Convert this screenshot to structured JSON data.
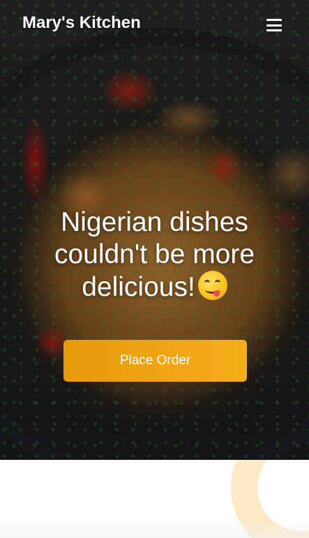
{
  "navbar": {
    "brand": "Mary's Kitchen",
    "menu_icon": "hamburger-menu-icon"
  },
  "hero": {
    "background_image": "jollof rice with shrimp and tomatoes in a dark pan",
    "headline": "Nigerian dishes couldn't be more delicious!",
    "headline_emoji_icon": "face-savoring-food-emoji",
    "cta_label": "Place Order"
  },
  "colors": {
    "cta_start": "#e69a0c",
    "cta_end": "#f6ad1a",
    "accent_ring": "#fde9c3",
    "text_on_hero": "#ffffff"
  }
}
